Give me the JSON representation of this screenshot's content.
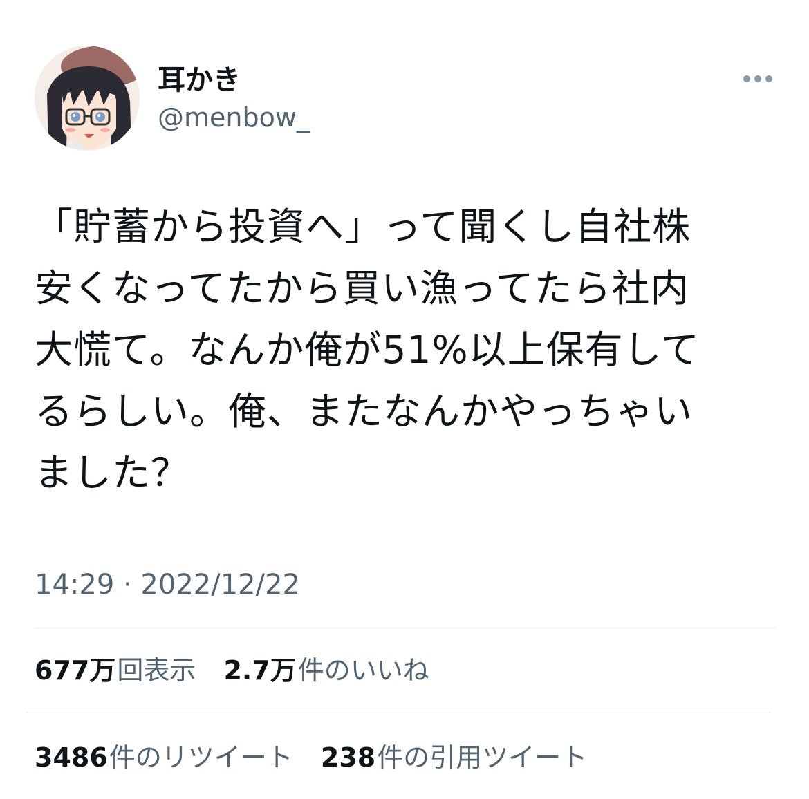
{
  "user": {
    "display_name": "耳かき",
    "handle": "@menbow_",
    "avatar_icon": "user-avatar-icon"
  },
  "more_icon": "more-horizontal-icon",
  "tweet": {
    "lines": [
      "「貯蓄から投資へ」って聞くし自社株",
      "安くなってたから買い漁ってたら社内",
      "大慌て。なんか俺が51%以上保有して",
      "るらしい。俺、またなんかやっちゃい",
      "ました？"
    ],
    "timestamp": "14:29 · 2022/12/22"
  },
  "stats": {
    "views": {
      "count": "677万",
      "label": "回表示"
    },
    "likes": {
      "count": "2.7万",
      "label": "件のいいね"
    },
    "retweets": {
      "count": "3486",
      "label": "件のリツイート"
    },
    "quotes": {
      "count": "238",
      "label": "件の引用ツイート"
    }
  },
  "colors": {
    "text_primary": "#0f1419",
    "text_secondary": "#536471",
    "divider": "#dfe3e7"
  }
}
